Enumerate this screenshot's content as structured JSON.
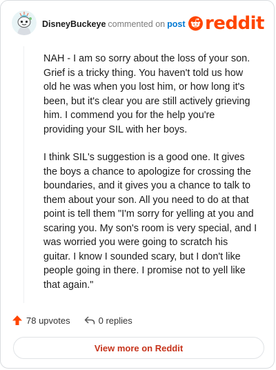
{
  "comment": {
    "username": "DisneyBuckeye",
    "action_text": "commented on",
    "post_link": "post",
    "logo_text": "reddit",
    "paragraphs": [
      "NAH - I am so sorry about the loss of your son. Grief is a tricky thing. You haven't told us how old he was when you lost him, or how long it's been, but it's clear you are still actively grieving him. I commend you for the help you're providing your SIL with her boys.",
      "I think SIL's suggestion is a good one. It gives the boys a chance to apologize for crossing the boundaries, and it gives you a chance to talk to them about your son. All you need to do at that point is tell them \"I'm sorry for yelling at you and scaring you. My son's room is very special, and I was worried you were going to scratch his guitar. I know I sounded scary, but I don't like people going in there. I promise not to yell like that again.\""
    ],
    "upvotes": "78 upvotes",
    "replies": "0 replies",
    "view_more": "View more on Reddit"
  },
  "colors": {
    "brand": "#ff4500",
    "link": "#0079d3",
    "view_more": "#c6331b"
  },
  "icons": [
    "avatar-snoo",
    "reddit-logo-icon",
    "upvote-arrow-icon",
    "reply-icon"
  ]
}
